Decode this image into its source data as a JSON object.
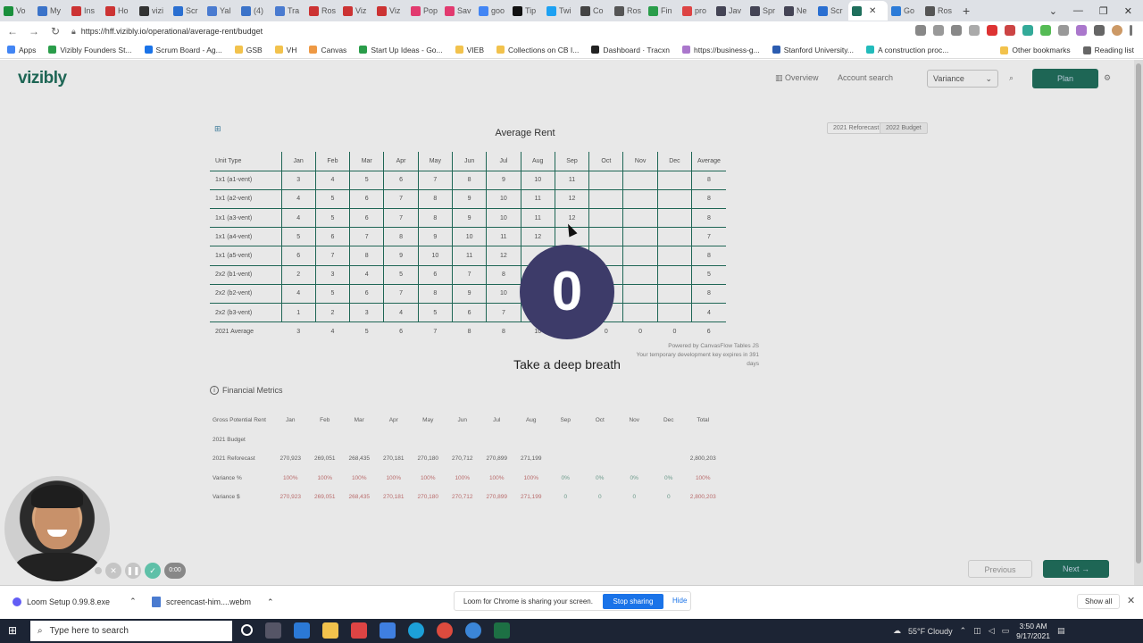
{
  "browser": {
    "tabs": [
      "Vo",
      "My",
      "Ins",
      "Ho",
      "vizi",
      "Scr",
      "Yal",
      "(4)",
      "Tra",
      "Ros",
      "Viz",
      "Viz",
      "Pop",
      "Sav",
      "goo",
      "Tip",
      "Twi",
      "Co",
      "Ros",
      "Fin",
      "pro",
      "Jav",
      "Spr",
      "Ne",
      "Scr",
      "",
      "Go",
      "Ros"
    ],
    "url": "https://hff.vizibly.io/operational/average-rent/budget",
    "bookmarks": [
      "Apps",
      "Vizibly Founders St...",
      "Scrum Board - Ag...",
      "GSB",
      "VH",
      "Canvas",
      "Start Up Ideas - Go...",
      "VIEB",
      "Collections on CB I...",
      "Dashboard · Tracxn",
      "https://business-g...",
      "Stanford University...",
      "A construction proc..."
    ],
    "bookmarks_right": [
      "Other bookmarks",
      "Reading list"
    ]
  },
  "app": {
    "logo": "vizibly",
    "nav": {
      "overview": "Overview",
      "account_search": "Account search",
      "variance": "Variance",
      "plan": "Plan"
    },
    "chart_title": "Average Rent",
    "toggles": [
      "2021 Reforecast",
      "2022 Budget"
    ],
    "rent_table": {
      "headers": [
        "Unit Type",
        "Jan",
        "Feb",
        "Mar",
        "Apr",
        "May",
        "Jun",
        "Jul",
        "Aug",
        "Sep",
        "Oct",
        "Nov",
        "Dec",
        "Average"
      ],
      "rows": [
        [
          "1x1 (a1-vent)",
          "3",
          "4",
          "5",
          "6",
          "7",
          "8",
          "9",
          "10",
          "11",
          "",
          "",
          "",
          "8"
        ],
        [
          "1x1 (a2-vent)",
          "4",
          "5",
          "6",
          "7",
          "8",
          "9",
          "10",
          "11",
          "12",
          "",
          "",
          "",
          "8"
        ],
        [
          "1x1 (a3-vent)",
          "4",
          "5",
          "6",
          "7",
          "8",
          "9",
          "10",
          "11",
          "12",
          "",
          "",
          "",
          "8"
        ],
        [
          "1x1 (a4-vent)",
          "5",
          "6",
          "7",
          "8",
          "9",
          "10",
          "11",
          "12",
          "",
          "",
          "",
          "",
          "7"
        ],
        [
          "1x1 (a5-vent)",
          "6",
          "7",
          "8",
          "9",
          "10",
          "11",
          "12",
          "",
          "",
          "",
          "",
          "",
          "8"
        ],
        [
          "2x2 (b1-vent)",
          "2",
          "3",
          "4",
          "5",
          "6",
          "7",
          "8",
          "",
          "",
          "",
          "",
          "",
          "5"
        ],
        [
          "2x2 (b2-vent)",
          "4",
          "5",
          "6",
          "7",
          "8",
          "9",
          "10",
          "",
          "",
          "",
          "",
          "",
          "8"
        ],
        [
          "2x2 (b3-vent)",
          "1",
          "2",
          "3",
          "4",
          "5",
          "6",
          "7",
          "",
          "",
          "",
          "",
          "",
          "4"
        ]
      ],
      "avg_row": [
        "2021 Average",
        "3",
        "4",
        "5",
        "6",
        "7",
        "8",
        "8",
        "10",
        "",
        "0",
        "0",
        "0",
        "6"
      ]
    },
    "footnote_1": "Powered by CanvasFlow Tables JS",
    "footnote_2": "Your temporary development key expires in 391 days",
    "fin_title": "Financial Metrics",
    "fin_table": {
      "headers": [
        "Gross Potential Rent",
        "Jan",
        "Feb",
        "Mar",
        "Apr",
        "May",
        "Jun",
        "Jul",
        "Aug",
        "Sep",
        "Oct",
        "Nov",
        "Dec",
        "Total"
      ],
      "rows": [
        [
          "2021 Budget",
          "",
          "",
          "",
          "",
          "",
          "",
          "",
          "",
          "",
          "",
          "",
          "",
          ""
        ],
        [
          "2021 Reforecast",
          "270,923",
          "269,051",
          "268,435",
          "270,181",
          "270,180",
          "270,712",
          "270,899",
          "271,199",
          "",
          "",
          "",
          "",
          "2,800,203"
        ],
        [
          "Variance %",
          "100%",
          "100%",
          "100%",
          "100%",
          "100%",
          "100%",
          "100%",
          "100%",
          "0%",
          "0%",
          "0%",
          "0%",
          "100%"
        ],
        [
          "Variance $",
          "270,923",
          "269,051",
          "268,435",
          "270,181",
          "270,180",
          "270,712",
          "270,899",
          "271,199",
          "0",
          "0",
          "0",
          "0",
          "2,800,203"
        ]
      ]
    },
    "pager": {
      "previous": "Previous",
      "next": "Next →"
    }
  },
  "overlay": {
    "countdown": "0",
    "message": "Take a deep breath",
    "timer": "0:00"
  },
  "downloads": {
    "items": [
      "Loom Setup 0.99.8.exe",
      "screencast-him....webm"
    ],
    "share_msg": "Loom for Chrome is sharing your screen.",
    "stop": "Stop sharing",
    "hide": "Hide",
    "show_all": "Show all"
  },
  "taskbar": {
    "search_placeholder": "Type here to search",
    "weather": "55°F Cloudy",
    "time": "3:50 AM",
    "date": "9/17/2021"
  },
  "colors": {
    "brand": "#1f6f5c",
    "countdown_bg": "#3d3b69",
    "stop_btn": "#1a73e8"
  }
}
